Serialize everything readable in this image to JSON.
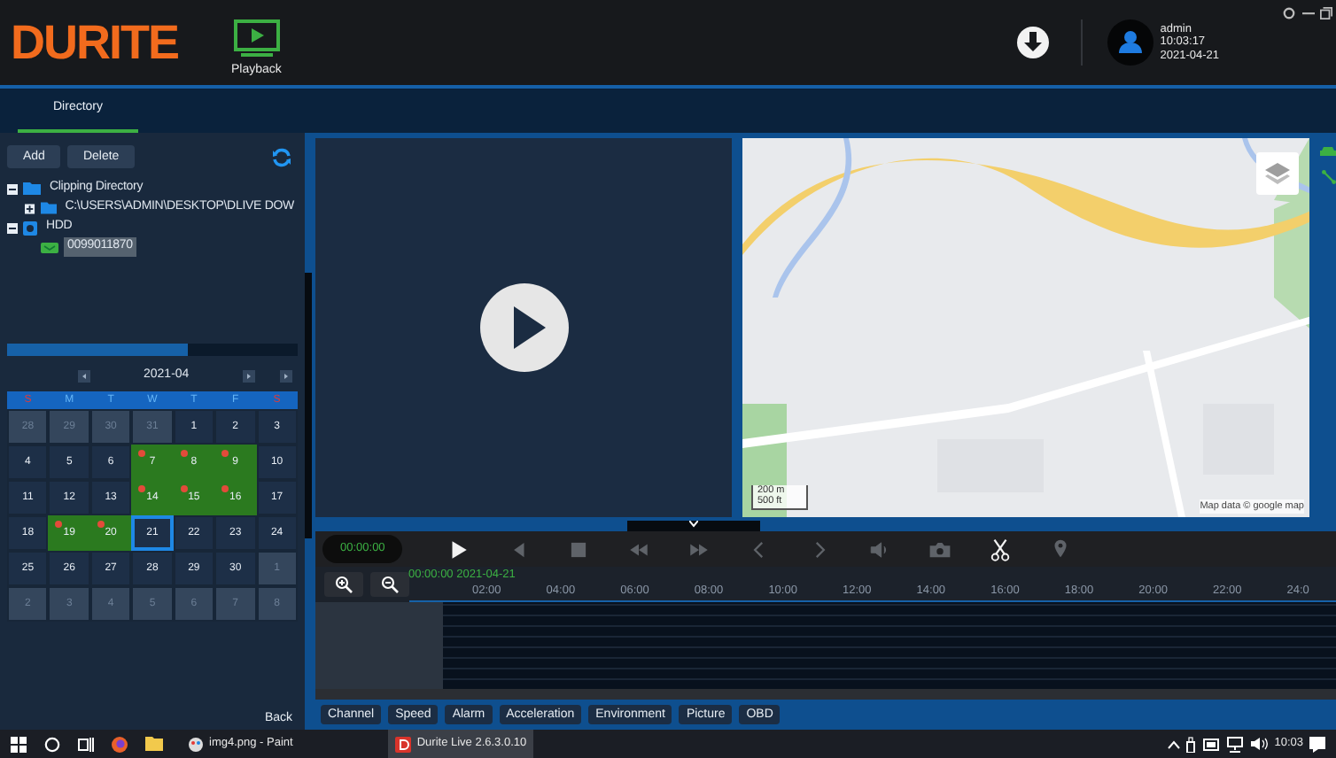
{
  "app": {
    "logo": "DURITE",
    "nav": [
      {
        "label": "Playback"
      }
    ],
    "user": "admin",
    "time": "10:03:17",
    "date": "2021-04-21"
  },
  "tabs": [
    {
      "label": "Directory",
      "selected": true
    }
  ],
  "directory": {
    "buttons": [
      "Add",
      "Delete"
    ],
    "tree": [
      {
        "label": "Clipping Directory",
        "kind": "folder",
        "expanded": true,
        "selected": false,
        "children": [
          {
            "label": "C:\\USERS\\ADMIN\\DESKTOP\\DLIVE DOW",
            "kind": "folder",
            "expanded": false,
            "selected": false
          }
        ]
      },
      {
        "label": "HDD",
        "kind": "disk",
        "expanded": true,
        "selected": false,
        "children": [
          {
            "label": "0099011870",
            "kind": "device",
            "selected": true
          }
        ]
      }
    ]
  },
  "calendar": {
    "month": "2021-04",
    "weekdays": [
      {
        "label": "S",
        "weekend": true
      },
      {
        "label": "M",
        "weekend": false
      },
      {
        "label": "T",
        "weekend": false
      },
      {
        "label": "W",
        "weekend": false
      },
      {
        "label": "T",
        "weekend": false
      },
      {
        "label": "F",
        "weekend": false
      },
      {
        "label": "S",
        "weekend": true
      }
    ],
    "weeks": [
      [
        {
          "day": "28",
          "kind": "other",
          "selected": false
        },
        {
          "day": "29",
          "kind": "other",
          "selected": false
        },
        {
          "day": "30",
          "kind": "other",
          "selected": false
        },
        {
          "day": "31",
          "kind": "other",
          "selected": false
        },
        {
          "day": "1",
          "kind": "normal",
          "selected": false
        },
        {
          "day": "2",
          "kind": "normal",
          "selected": false
        },
        {
          "day": "3",
          "kind": "normal",
          "selected": false
        }
      ],
      [
        {
          "day": "4",
          "kind": "normal",
          "selected": false
        },
        {
          "day": "5",
          "kind": "normal",
          "selected": false
        },
        {
          "day": "6",
          "kind": "normal",
          "selected": false
        },
        {
          "day": "7",
          "kind": "recorded",
          "selected": false
        },
        {
          "day": "8",
          "kind": "recorded",
          "selected": false
        },
        {
          "day": "9",
          "kind": "recorded",
          "selected": false
        },
        {
          "day": "10",
          "kind": "normal",
          "selected": false
        }
      ],
      [
        {
          "day": "11",
          "kind": "normal",
          "selected": false
        },
        {
          "day": "12",
          "kind": "normal",
          "selected": false
        },
        {
          "day": "13",
          "kind": "normal",
          "selected": false
        },
        {
          "day": "14",
          "kind": "recorded",
          "selected": false
        },
        {
          "day": "15",
          "kind": "recorded",
          "selected": false
        },
        {
          "day": "16",
          "kind": "recorded",
          "selected": false
        },
        {
          "day": "17",
          "kind": "normal",
          "selected": false
        }
      ],
      [
        {
          "day": "18",
          "kind": "normal",
          "selected": false
        },
        {
          "day": "19",
          "kind": "recorded",
          "selected": false
        },
        {
          "day": "20",
          "kind": "recorded",
          "selected": false
        },
        {
          "day": "21",
          "kind": "normal",
          "selected": true
        },
        {
          "day": "22",
          "kind": "normal",
          "selected": false
        },
        {
          "day": "23",
          "kind": "normal",
          "selected": false
        },
        {
          "day": "24",
          "kind": "normal",
          "selected": false
        }
      ],
      [
        {
          "day": "25",
          "kind": "normal",
          "selected": false
        },
        {
          "day": "26",
          "kind": "normal",
          "selected": false
        },
        {
          "day": "27",
          "kind": "normal",
          "selected": false
        },
        {
          "day": "28",
          "kind": "normal",
          "selected": false
        },
        {
          "day": "29",
          "kind": "normal",
          "selected": false
        },
        {
          "day": "30",
          "kind": "normal",
          "selected": false
        },
        {
          "day": "1",
          "kind": "other",
          "selected": false
        }
      ],
      [
        {
          "day": "2",
          "kind": "other",
          "selected": false
        },
        {
          "day": "3",
          "kind": "other",
          "selected": false
        },
        {
          "day": "4",
          "kind": "other",
          "selected": false
        },
        {
          "day": "5",
          "kind": "other",
          "selected": false
        },
        {
          "day": "6",
          "kind": "other",
          "selected": false
        },
        {
          "day": "7",
          "kind": "other",
          "selected": false
        },
        {
          "day": "8",
          "kind": "other",
          "selected": false
        }
      ]
    ]
  },
  "back_button": "Back",
  "map": {
    "scale": [
      "200 m",
      "500 ft"
    ],
    "attribution": "Map data © google map"
  },
  "player": {
    "time": "00:00:00",
    "controls": [
      {
        "kind": "play",
        "disabled": false
      },
      {
        "kind": "prev_frame",
        "disabled": true
      },
      {
        "kind": "stop",
        "disabled": true
      },
      {
        "kind": "rewind",
        "disabled": true
      },
      {
        "kind": "fast_forward",
        "disabled": true
      },
      {
        "kind": "prev",
        "disabled": true
      },
      {
        "kind": "next",
        "disabled": true
      },
      {
        "kind": "volume",
        "disabled": true
      },
      {
        "kind": "camera",
        "disabled": true
      },
      {
        "kind": "cut",
        "disabled": false
      },
      {
        "kind": "pin",
        "disabled": true
      }
    ],
    "timeline_start": "00:00:00 2021-04-21",
    "ticks": [
      "02:00",
      "04:00",
      "06:00",
      "08:00",
      "10:00",
      "12:00",
      "14:00",
      "16:00",
      "18:00",
      "20:00",
      "22:00",
      "24:0"
    ]
  },
  "bottom_tabs": [
    {
      "label": "Channel"
    },
    {
      "label": "Speed"
    },
    {
      "label": "Alarm"
    },
    {
      "label": "Acceleration"
    },
    {
      "label": "Environment"
    },
    {
      "label": "Picture"
    },
    {
      "label": "OBD"
    }
  ],
  "taskbar": {
    "items": [
      {
        "label": "img4.png - Paint",
        "selected": false
      },
      {
        "label": "Durite Live 2.6.3.0.10",
        "selected": true
      }
    ],
    "clock": "10:03"
  }
}
